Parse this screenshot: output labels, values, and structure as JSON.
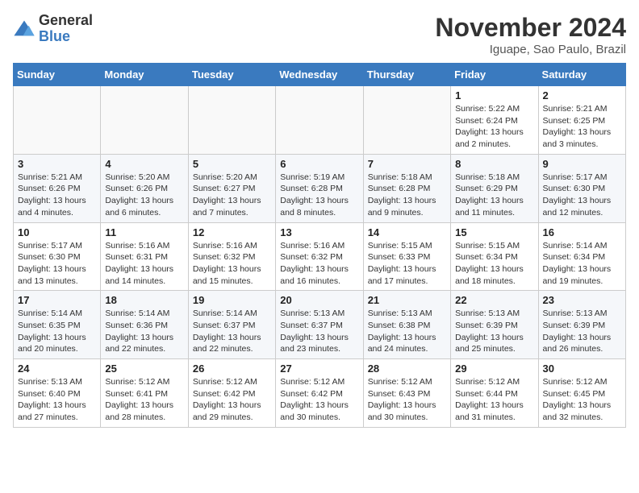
{
  "logo": {
    "general": "General",
    "blue": "Blue"
  },
  "title": "November 2024",
  "location": "Iguape, Sao Paulo, Brazil",
  "days_of_week": [
    "Sunday",
    "Monday",
    "Tuesday",
    "Wednesday",
    "Thursday",
    "Friday",
    "Saturday"
  ],
  "weeks": [
    [
      {
        "day": "",
        "info": ""
      },
      {
        "day": "",
        "info": ""
      },
      {
        "day": "",
        "info": ""
      },
      {
        "day": "",
        "info": ""
      },
      {
        "day": "",
        "info": ""
      },
      {
        "day": "1",
        "info": "Sunrise: 5:22 AM\nSunset: 6:24 PM\nDaylight: 13 hours and 2 minutes."
      },
      {
        "day": "2",
        "info": "Sunrise: 5:21 AM\nSunset: 6:25 PM\nDaylight: 13 hours and 3 minutes."
      }
    ],
    [
      {
        "day": "3",
        "info": "Sunrise: 5:21 AM\nSunset: 6:26 PM\nDaylight: 13 hours and 4 minutes."
      },
      {
        "day": "4",
        "info": "Sunrise: 5:20 AM\nSunset: 6:26 PM\nDaylight: 13 hours and 6 minutes."
      },
      {
        "day": "5",
        "info": "Sunrise: 5:20 AM\nSunset: 6:27 PM\nDaylight: 13 hours and 7 minutes."
      },
      {
        "day": "6",
        "info": "Sunrise: 5:19 AM\nSunset: 6:28 PM\nDaylight: 13 hours and 8 minutes."
      },
      {
        "day": "7",
        "info": "Sunrise: 5:18 AM\nSunset: 6:28 PM\nDaylight: 13 hours and 9 minutes."
      },
      {
        "day": "8",
        "info": "Sunrise: 5:18 AM\nSunset: 6:29 PM\nDaylight: 13 hours and 11 minutes."
      },
      {
        "day": "9",
        "info": "Sunrise: 5:17 AM\nSunset: 6:30 PM\nDaylight: 13 hours and 12 minutes."
      }
    ],
    [
      {
        "day": "10",
        "info": "Sunrise: 5:17 AM\nSunset: 6:30 PM\nDaylight: 13 hours and 13 minutes."
      },
      {
        "day": "11",
        "info": "Sunrise: 5:16 AM\nSunset: 6:31 PM\nDaylight: 13 hours and 14 minutes."
      },
      {
        "day": "12",
        "info": "Sunrise: 5:16 AM\nSunset: 6:32 PM\nDaylight: 13 hours and 15 minutes."
      },
      {
        "day": "13",
        "info": "Sunrise: 5:16 AM\nSunset: 6:32 PM\nDaylight: 13 hours and 16 minutes."
      },
      {
        "day": "14",
        "info": "Sunrise: 5:15 AM\nSunset: 6:33 PM\nDaylight: 13 hours and 17 minutes."
      },
      {
        "day": "15",
        "info": "Sunrise: 5:15 AM\nSunset: 6:34 PM\nDaylight: 13 hours and 18 minutes."
      },
      {
        "day": "16",
        "info": "Sunrise: 5:14 AM\nSunset: 6:34 PM\nDaylight: 13 hours and 19 minutes."
      }
    ],
    [
      {
        "day": "17",
        "info": "Sunrise: 5:14 AM\nSunset: 6:35 PM\nDaylight: 13 hours and 20 minutes."
      },
      {
        "day": "18",
        "info": "Sunrise: 5:14 AM\nSunset: 6:36 PM\nDaylight: 13 hours and 22 minutes."
      },
      {
        "day": "19",
        "info": "Sunrise: 5:14 AM\nSunset: 6:37 PM\nDaylight: 13 hours and 22 minutes."
      },
      {
        "day": "20",
        "info": "Sunrise: 5:13 AM\nSunset: 6:37 PM\nDaylight: 13 hours and 23 minutes."
      },
      {
        "day": "21",
        "info": "Sunrise: 5:13 AM\nSunset: 6:38 PM\nDaylight: 13 hours and 24 minutes."
      },
      {
        "day": "22",
        "info": "Sunrise: 5:13 AM\nSunset: 6:39 PM\nDaylight: 13 hours and 25 minutes."
      },
      {
        "day": "23",
        "info": "Sunrise: 5:13 AM\nSunset: 6:39 PM\nDaylight: 13 hours and 26 minutes."
      }
    ],
    [
      {
        "day": "24",
        "info": "Sunrise: 5:13 AM\nSunset: 6:40 PM\nDaylight: 13 hours and 27 minutes."
      },
      {
        "day": "25",
        "info": "Sunrise: 5:12 AM\nSunset: 6:41 PM\nDaylight: 13 hours and 28 minutes."
      },
      {
        "day": "26",
        "info": "Sunrise: 5:12 AM\nSunset: 6:42 PM\nDaylight: 13 hours and 29 minutes."
      },
      {
        "day": "27",
        "info": "Sunrise: 5:12 AM\nSunset: 6:42 PM\nDaylight: 13 hours and 30 minutes."
      },
      {
        "day": "28",
        "info": "Sunrise: 5:12 AM\nSunset: 6:43 PM\nDaylight: 13 hours and 30 minutes."
      },
      {
        "day": "29",
        "info": "Sunrise: 5:12 AM\nSunset: 6:44 PM\nDaylight: 13 hours and 31 minutes."
      },
      {
        "day": "30",
        "info": "Sunrise: 5:12 AM\nSunset: 6:45 PM\nDaylight: 13 hours and 32 minutes."
      }
    ]
  ]
}
